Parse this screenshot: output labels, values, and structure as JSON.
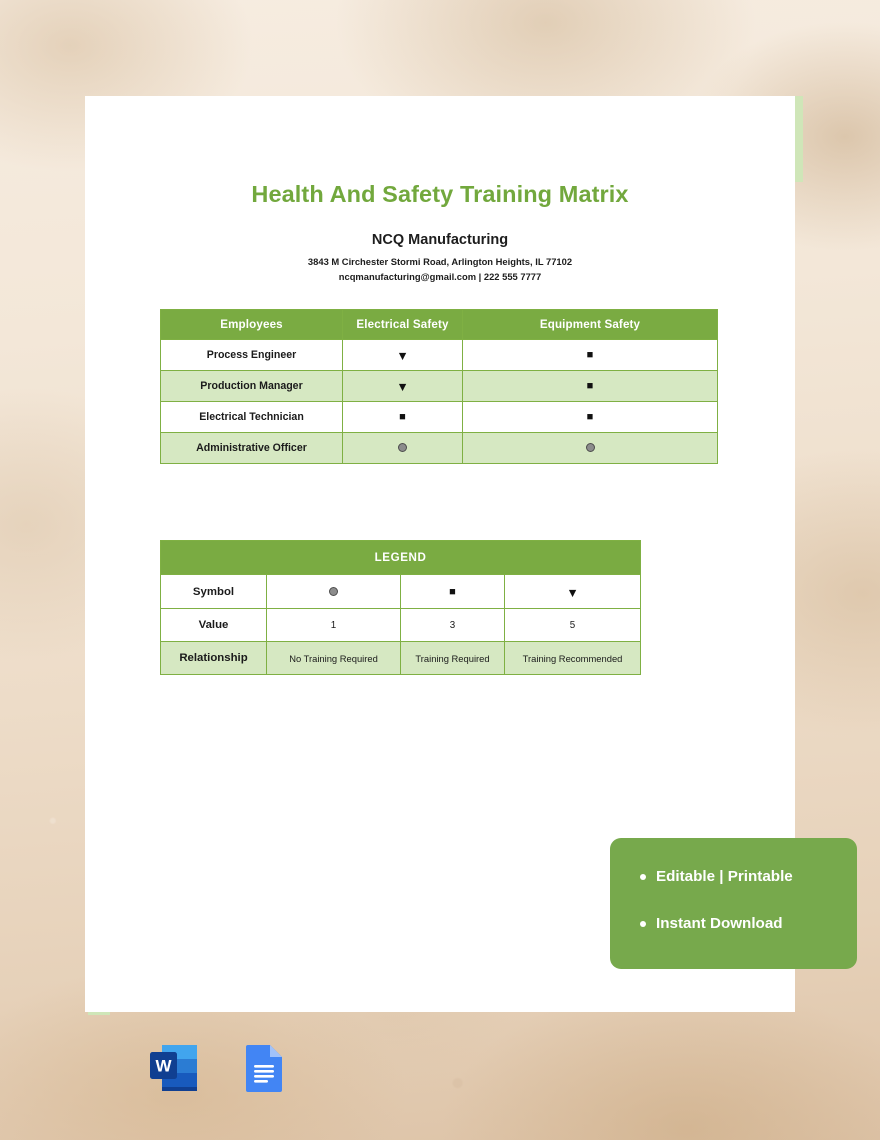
{
  "page": {
    "title": "Health And Safety Training Matrix",
    "company_name": "NCQ Manufacturing",
    "company_address": "3843 M Circhester Stormi Road, Arlington Heights, IL 77102",
    "company_contact": "ncqmanufacturing@gmail.com | 222 555 7777"
  },
  "colors": {
    "header_green": "#7AAB42",
    "row_tint_green": "#D6E8C2",
    "title_green": "#72A83D",
    "border_green": "#7FB043",
    "badge_green": "#77A94C",
    "accent_strip_green": "#CFE6B8",
    "symbol_dark": "#111111",
    "symbol_circle_fill": "#8C8C8C"
  },
  "matrix_table": {
    "headers": [
      "Employees",
      "Electrical Safety",
      "Equipment Safety"
    ],
    "rows": [
      {
        "employee": "Process Engineer",
        "electrical_safety": "triangle",
        "equipment_safety": "square"
      },
      {
        "employee": "Production Manager",
        "electrical_safety": "triangle",
        "equipment_safety": "square"
      },
      {
        "employee": "Electrical Technician",
        "electrical_safety": "square",
        "equipment_safety": "square"
      },
      {
        "employee": "Administrative Officer",
        "electrical_safety": "circle",
        "equipment_safety": "circle"
      }
    ]
  },
  "legend_table": {
    "title": "LEGEND",
    "row_labels": [
      "Symbol",
      "Value",
      "Relationship"
    ],
    "entries": [
      {
        "symbol": "circle",
        "value": "1",
        "relationship": "No Training Required"
      },
      {
        "symbol": "square",
        "value": "3",
        "relationship": "Training Required"
      },
      {
        "symbol": "triangle",
        "value": "5",
        "relationship": "Training Recommended"
      }
    ]
  },
  "promo_badge": {
    "line_1": "Editable | Printable",
    "line_2": "Instant Download"
  },
  "app_icons": [
    {
      "name": "microsoft-word-icon",
      "label": "W"
    },
    {
      "name": "google-docs-icon",
      "label": ""
    }
  ]
}
